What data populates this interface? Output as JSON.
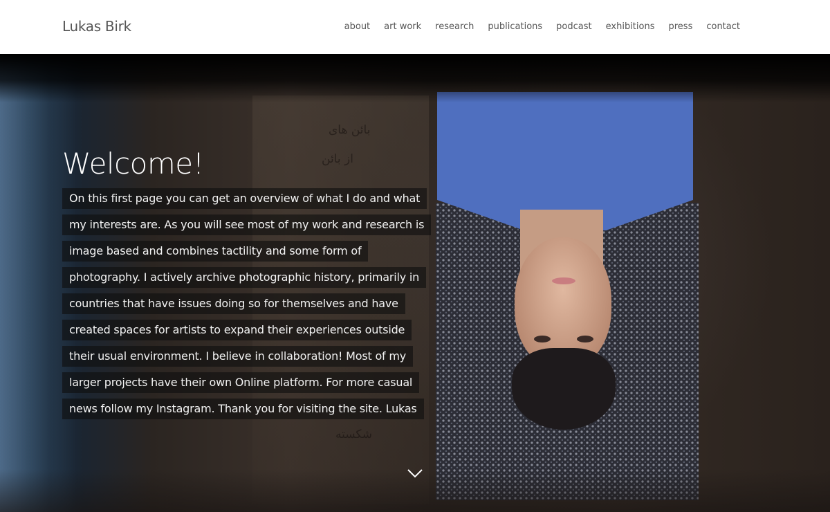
{
  "site": {
    "logo": "Lukas Birk"
  },
  "nav": {
    "items": [
      {
        "label": "about"
      },
      {
        "label": "art work"
      },
      {
        "label": "research"
      },
      {
        "label": "publications"
      },
      {
        "label": "podcast"
      },
      {
        "label": "exhibitions"
      },
      {
        "label": "press"
      },
      {
        "label": "contact"
      }
    ]
  },
  "hero": {
    "heading": "Welcome!",
    "intro_lines": [
      "On this first page you can get an overview of what I do and what",
      "my interests are. As you will see most of my work and research is",
      "image based and combines tactility and some form of",
      "photography. I actively archive photographic history, primarily in",
      "countries that have issues doing so for themselves and have",
      "created spaces for artists to expand their experiences outside",
      "their usual environment. I believe in collaboration! Most of my",
      "larger projects have their own Online platform. For more casual",
      "news follow my Instagram. Thank you for visiting the site. Lukas"
    ],
    "scroll_icon": "chevron-down-icon"
  },
  "colors": {
    "header_bg": "#ffffff",
    "nav_text": "#555555",
    "heading_text": "#ffffff",
    "caption_bg": "rgba(15,15,15,0.62)"
  }
}
